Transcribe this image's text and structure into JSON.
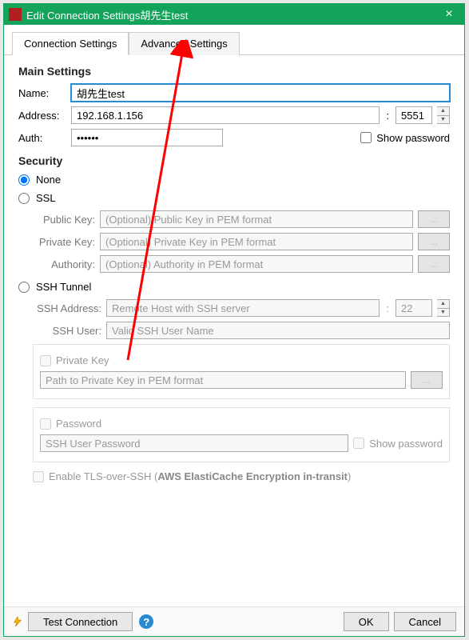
{
  "titlebar": {
    "title": "Edit Connection Settings胡先生test"
  },
  "tabs": {
    "connection": "Connection Settings",
    "advanced": "Advanced Settings"
  },
  "main": {
    "heading": "Main Settings",
    "name_label": "Name:",
    "name_value": "胡先生test",
    "address_label": "Address:",
    "address_value": "192.168.1.156",
    "port_value": "5551",
    "auth_label": "Auth:",
    "auth_value": "••••••",
    "show_password": "Show password"
  },
  "security": {
    "heading": "Security",
    "none": "None",
    "ssl": "SSL",
    "public_key_label": "Public Key:",
    "public_key_ph": "(Optional) Public Key in PEM format",
    "private_key_label": "Private Key:",
    "private_key_ph": "(Optional) Private Key in PEM format",
    "authority_label": "Authority:",
    "authority_ph": "(Optional) Authority in PEM format",
    "browse": "...",
    "ssh_tunnel": "SSH Tunnel",
    "ssh_address_label": "SSH Address:",
    "ssh_address_ph": "Remote Host with SSH server",
    "ssh_port_value": "22",
    "ssh_user_label": "SSH User:",
    "ssh_user_ph": "Valid SSH User Name",
    "private_key_chk": "Private Key",
    "pk_path_ph": "Path to Private Key in PEM format",
    "password_chk": "Password",
    "ssh_password_ph": "SSH User Password",
    "ssh_show_password": "Show password",
    "tls_over_ssh_prefix": "Enable TLS-over-SSH (",
    "tls_over_ssh_aws": "AWS ElastiCache Encryption in-transit",
    "tls_over_ssh_suffix": ")"
  },
  "footer": {
    "test_connection": "Test Connection",
    "ok": "OK",
    "cancel": "Cancel"
  },
  "icons": {
    "close": "×",
    "help": "?"
  }
}
